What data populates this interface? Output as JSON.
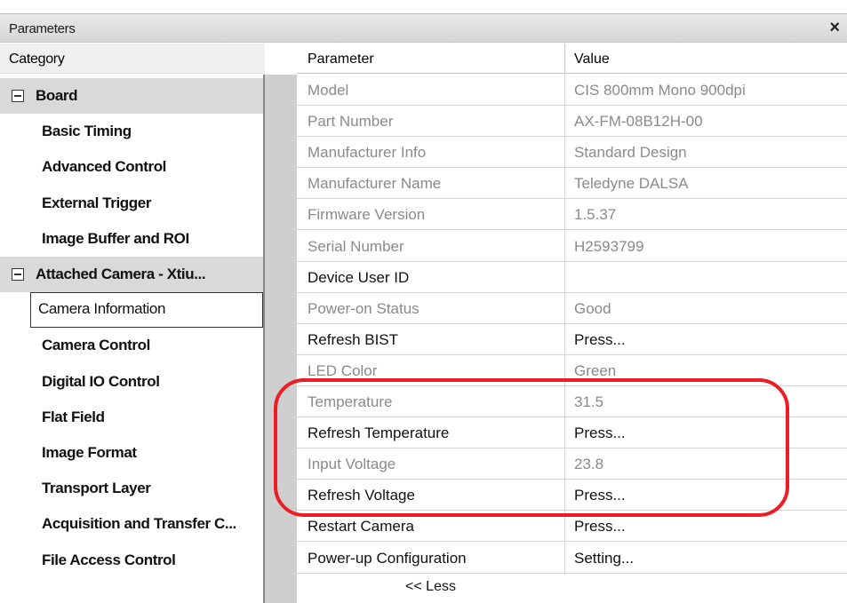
{
  "window": {
    "title": "Parameters",
    "close_glyph": "×"
  },
  "headers": {
    "category": "Category",
    "parameter": "Parameter",
    "value": "Value"
  },
  "categories": [
    {
      "label": "Board",
      "group": true
    },
    {
      "label": "Basic Timing"
    },
    {
      "label": "Advanced Control"
    },
    {
      "label": "External Trigger"
    },
    {
      "label": "Image Buffer and ROI"
    },
    {
      "label": "Attached Camera - Xtiu...",
      "group": true
    },
    {
      "label": "Camera Information",
      "selected": true
    },
    {
      "label": "Camera Control"
    },
    {
      "label": "Digital IO Control"
    },
    {
      "label": "Flat Field"
    },
    {
      "label": "Image Format"
    },
    {
      "label": "Transport Layer"
    },
    {
      "label": "Acquisition and Transfer C..."
    },
    {
      "label": "File Access Control"
    }
  ],
  "parameters": [
    {
      "name": "Model",
      "value": "CIS 800mm Mono 900dpi",
      "editable": false
    },
    {
      "name": "Part Number",
      "value": "AX-FM-08B12H-00",
      "editable": false
    },
    {
      "name": "Manufacturer Info",
      "value": "Standard Design",
      "editable": false
    },
    {
      "name": "Manufacturer Name",
      "value": "Teledyne DALSA",
      "editable": false
    },
    {
      "name": "Firmware Version",
      "value": "1.5.37",
      "editable": false
    },
    {
      "name": "Serial Number",
      "value": "H2593799",
      "editable": false
    },
    {
      "name": "Device User ID",
      "value": "",
      "editable": true
    },
    {
      "name": "Power-on Status",
      "value": "Good",
      "editable": false
    },
    {
      "name": "Refresh BIST",
      "value": "Press...",
      "editable": true
    },
    {
      "name": "LED Color",
      "value": "Green",
      "editable": false
    },
    {
      "name": "Temperature",
      "value": "31.5",
      "editable": false
    },
    {
      "name": "Refresh Temperature",
      "value": "Press...",
      "editable": true
    },
    {
      "name": "Input Voltage",
      "value": "23.8",
      "editable": false
    },
    {
      "name": "Refresh Voltage",
      "value": "Press...",
      "editable": true
    },
    {
      "name": "Restart Camera",
      "value": "Press...",
      "editable": true
    },
    {
      "name": "Power-up Configuration",
      "value": "Setting...",
      "editable": true
    }
  ],
  "less_link": "<< Less",
  "colors": {
    "highlight": "#ee1c24",
    "readonly_text": "#8a8a8a",
    "group_bg": "#d9d9d9"
  },
  "icons": {
    "group_toggle": "collapse-minus-icon",
    "close": "close-icon"
  }
}
